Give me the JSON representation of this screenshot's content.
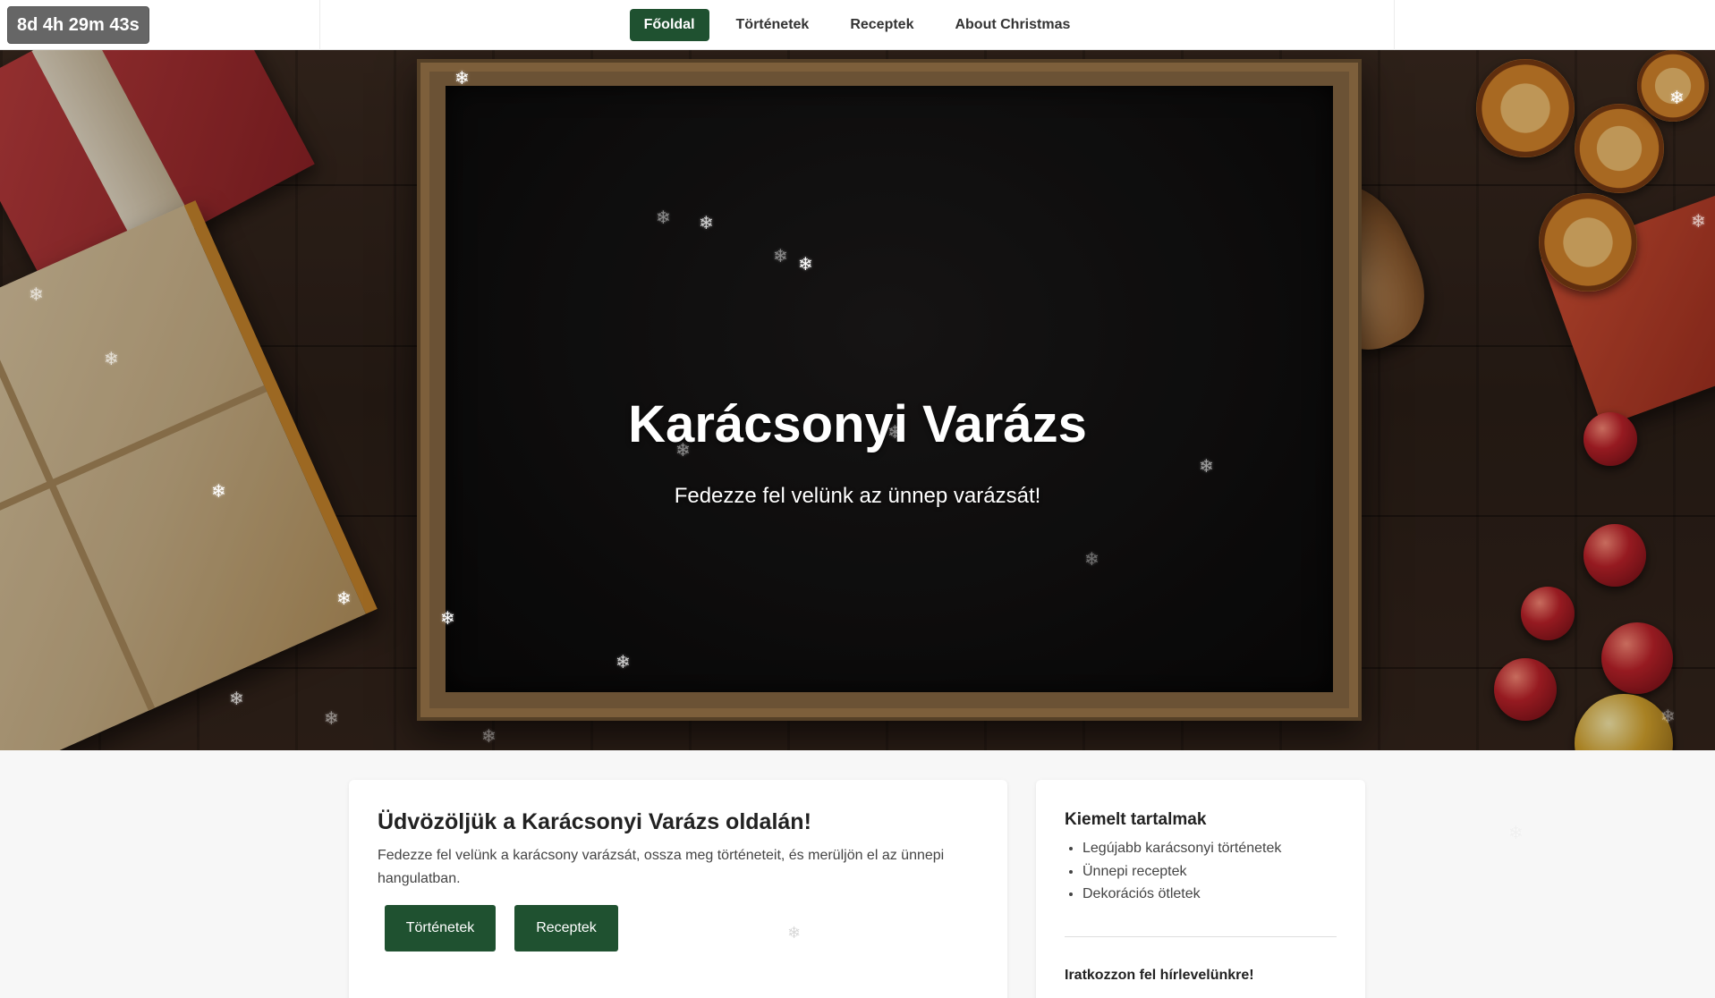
{
  "countdown": "8d 4h 29m 43s",
  "nav": {
    "items": [
      {
        "label": "Főoldal",
        "active": true
      },
      {
        "label": "Történetek",
        "active": false
      },
      {
        "label": "Receptek",
        "active": false
      },
      {
        "label": "About Christmas",
        "active": false
      }
    ]
  },
  "hero": {
    "title": "Karácsonyi Varázs",
    "subtitle": "Fedezze fel velünk az ünnep varázsát!"
  },
  "welcome": {
    "title": "Üdvözöljük a Karácsonyi Varázs oldalán!",
    "text": "Fedezze fel velünk a karácsony varázsát, ossza meg történeteit, és merüljön el az ünnepi hangulatban.",
    "buttons": [
      {
        "label": "Történetek"
      },
      {
        "label": "Receptek"
      }
    ]
  },
  "sidebar": {
    "title": "Kiemelt tartalmak",
    "items": [
      "Legújabb karácsonyi történetek",
      "Ünnepi receptek",
      "Dekorációs ötletek"
    ],
    "newsletter_title": "Iratkozzon fel hírlevelünkre!"
  },
  "snowflake_icon": "❄",
  "colors": {
    "accent": "#1f5130",
    "countdown_bg": "#666666"
  }
}
